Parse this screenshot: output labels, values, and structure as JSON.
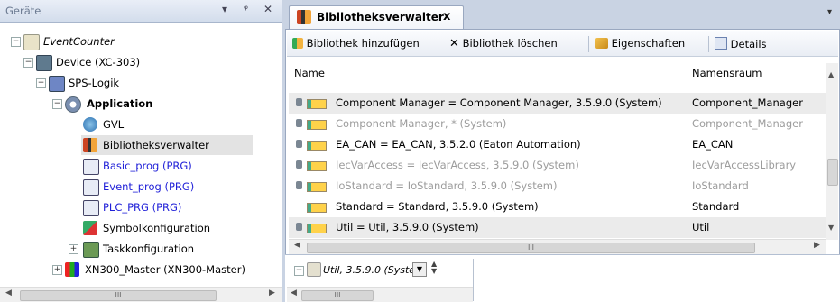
{
  "left_panel": {
    "title": "Geräte",
    "controls": {
      "dropdown": "▾",
      "pin": "ᵠ",
      "close": "✕"
    },
    "tree": [
      {
        "label": "EventCounter",
        "style": "ital",
        "icon": "project-icon"
      },
      {
        "label": "Device (XC-303)",
        "icon": "device-icon"
      },
      {
        "label": "SPS-Logik",
        "icon": "plc-logic-icon"
      },
      {
        "label": "Application",
        "style": "bold",
        "icon": "application-icon"
      },
      {
        "label": "GVL",
        "icon": "gvl-icon"
      },
      {
        "label": "Bibliotheksverwalter",
        "icon": "library-manager-icon"
      },
      {
        "label": "Basic_prog (PRG)",
        "style": "blue",
        "icon": "program-icon"
      },
      {
        "label": "Event_prog (PRG)",
        "style": "blue",
        "icon": "program-icon"
      },
      {
        "label": "PLC_PRG (PRG)",
        "style": "blue",
        "icon": "program-icon"
      },
      {
        "label": "Symbolkonfiguration",
        "icon": "symbol-config-icon"
      },
      {
        "label": "Taskkonfiguration",
        "icon": "task-config-icon"
      },
      {
        "label": "XN300_Master (XN300-Master)",
        "icon": "xn300-icon"
      }
    ],
    "hscroll_thumb": "III"
  },
  "editor": {
    "tab": {
      "title": "Bibliotheksverwalter",
      "close": "x"
    },
    "toolbar": {
      "add": "Bibliothek hinzufügen",
      "delete": "Bibliothek löschen",
      "props": "Eigenschaften",
      "details": "Details"
    },
    "columns": {
      "name": "Name",
      "namespace": "Namensraum"
    },
    "rows": [
      {
        "name": "Component Manager = Component Manager, 3.5.9.0 (System)",
        "ns": "Component_Manager",
        "gray": false,
        "selected": true
      },
      {
        "name": "Component Manager, * (System)",
        "ns": "Component_Manager",
        "gray": true,
        "selected": false
      },
      {
        "name": "EA_CAN = EA_CAN, 3.5.2.0 (Eaton Automation)",
        "ns": "EA_CAN",
        "gray": false,
        "selected": false
      },
      {
        "name": "IecVarAccess = IecVarAccess, 3.5.9.0 (System)",
        "ns": "IecVarAccessLibrary",
        "gray": true,
        "selected": false
      },
      {
        "name": "IoStandard = IoStandard, 3.5.9.0 (System)",
        "ns": "IoStandard",
        "gray": true,
        "selected": false
      },
      {
        "name": "Standard = Standard, 3.5.9.0 (System)",
        "ns": "Standard",
        "gray": false,
        "selected": false
      },
      {
        "name": "Util = Util, 3.5.9.0 (System)",
        "ns": "Util",
        "gray": false,
        "selected": true
      }
    ],
    "hscroll_thumb": "III",
    "bottom": {
      "selector_text": "Util, 3.5.9.0 (Syste",
      "hscroll_thumb": "III"
    }
  }
}
